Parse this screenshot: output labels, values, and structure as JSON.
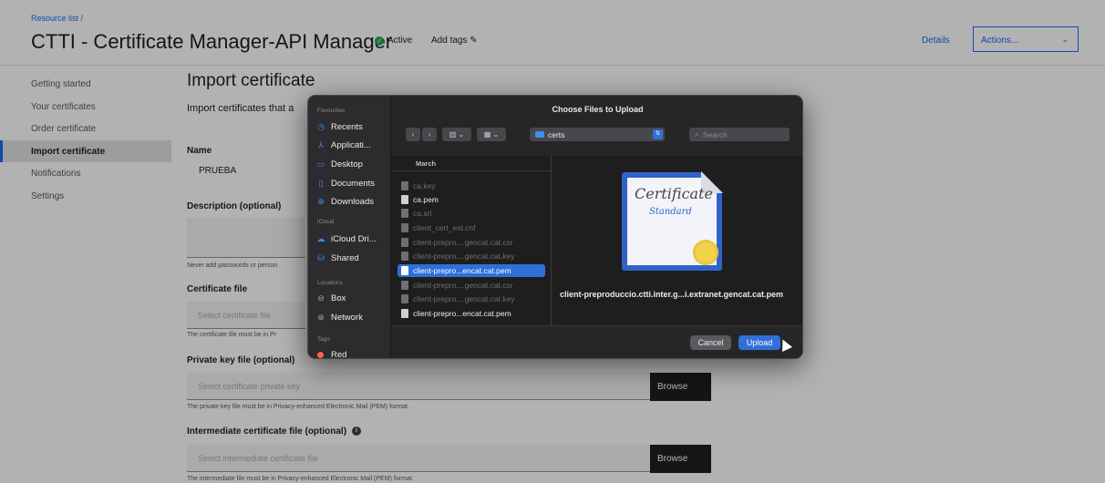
{
  "header": {
    "breadcrumb": "Resource list",
    "breadcrumb_sep": "/",
    "title": "CTTI - Certificate Manager-API Manager",
    "status": "Active",
    "add_tags": "Add tags",
    "details": "Details",
    "actions": "Actions..."
  },
  "sidebar_nav": {
    "items": [
      {
        "label": "Getting started"
      },
      {
        "label": "Your certificates"
      },
      {
        "label": "Order certificate"
      },
      {
        "label": "Import certificate"
      },
      {
        "label": "Notifications"
      },
      {
        "label": "Settings"
      }
    ],
    "active": "Import certificate"
  },
  "form": {
    "heading": "Import certificate",
    "subtitle": "Import certificates that a",
    "name_label": "Name",
    "name_value": "PRUEBA",
    "description_label": "Description (optional)",
    "description_helper": "Never add passwords or person",
    "cert_file_label": "Certificate file",
    "cert_file_placeholder": "Select certificate file",
    "cert_file_helper": "The certificate file must be in Pr",
    "private_key_label": "Private key file (optional)",
    "private_key_placeholder": "Select certificate private key",
    "private_key_helper": "The private key file must be in Privacy-enhanced Electronic Mail (PEM) format.",
    "intermediate_label": "Intermediate certificate file (optional)",
    "intermediate_placeholder": "Select intermediate certificate file",
    "intermediate_helper": "The intermediate file must be in Privacy-enhanced Electronic Mail (PEM) format.",
    "browse": "Browse"
  },
  "dialog": {
    "title": "Choose Files to Upload",
    "favourites_header": "Favourites",
    "favourites": [
      {
        "label": "Recents",
        "icon": "clock-icon"
      },
      {
        "label": "Applicati...",
        "icon": "apps-icon"
      },
      {
        "label": "Desktop",
        "icon": "desktop-icon"
      },
      {
        "label": "Documents",
        "icon": "document-icon"
      },
      {
        "label": "Downloads",
        "icon": "download-icon"
      }
    ],
    "icloud_header": "iCloud",
    "icloud": [
      {
        "label": "iCloud Dri...",
        "icon": "cloud-icon"
      },
      {
        "label": "Shared",
        "icon": "shared-folder-icon"
      }
    ],
    "locations_header": "Locations",
    "locations": [
      {
        "label": "Box",
        "icon": "drive-icon"
      },
      {
        "label": "Network",
        "icon": "globe-icon"
      }
    ],
    "tags_header": "Tags",
    "tags": [
      {
        "label": "Red",
        "color": "#ff5f57"
      }
    ],
    "folder": "certs",
    "search_placeholder": "Search",
    "list_header": "March",
    "files": [
      {
        "name": "ca.key",
        "state": "dim"
      },
      {
        "name": "ca.pem",
        "state": "enabled"
      },
      {
        "name": "ca.srl",
        "state": "dim"
      },
      {
        "name": "client_cert_ext.cnf",
        "state": "dim"
      },
      {
        "name": "client-prepro....gencat.cat.csr",
        "state": "dim"
      },
      {
        "name": "client-prepro....gencat.cat.key",
        "state": "dim"
      },
      {
        "name": "client-prepro...encat.cat.pem",
        "state": "selected"
      },
      {
        "name": "client-prepro....gencat.cat.csr",
        "state": "dim"
      },
      {
        "name": "client-prepro....gencat.cat.key",
        "state": "dim"
      },
      {
        "name": "client-prepro...encat.cat.pem",
        "state": "enabled"
      }
    ],
    "preview_cert_title": "Certificate",
    "preview_cert_subtitle": "Standard",
    "preview_name": "client-preproduccio.ctti.inter.g...i.extranet.gencat.cat.pem",
    "cancel": "Cancel",
    "upload": "Upload"
  },
  "colors": {
    "accent": "#0f62fe",
    "mac_accent": "#2f6fd8",
    "status_green": "#24a148"
  }
}
